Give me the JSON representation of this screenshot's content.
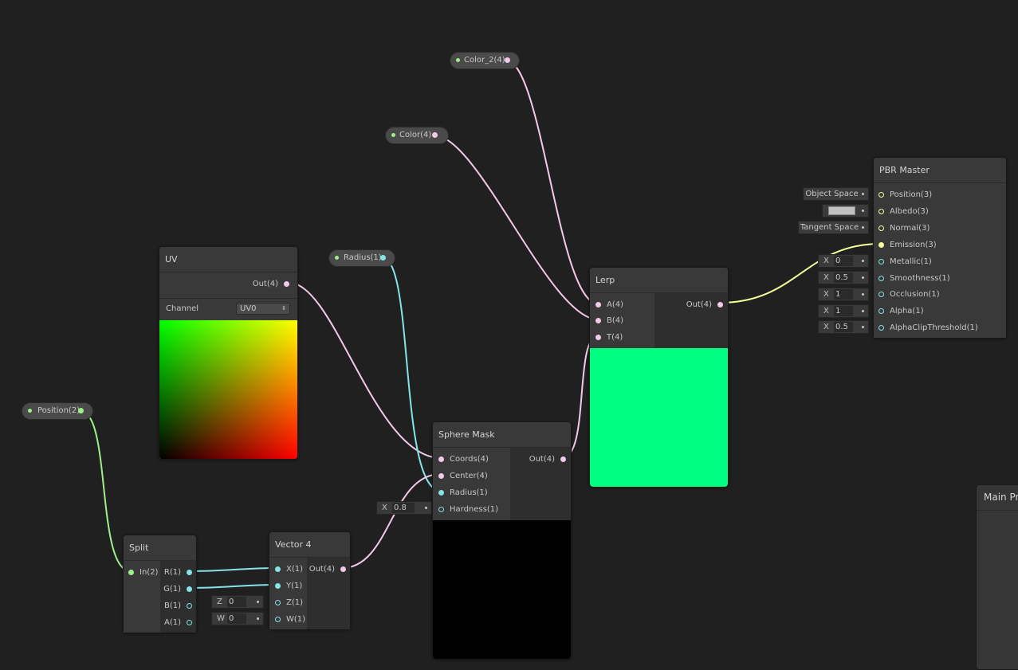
{
  "nodes": {
    "uv": {
      "title": "UV",
      "out": "Out(4)",
      "channel_label": "Channel",
      "channel_value": "UV0"
    },
    "split": {
      "title": "Split",
      "in": "In(2)",
      "outs": [
        "R(1)",
        "G(1)",
        "B(1)",
        "A(1)"
      ]
    },
    "vector4": {
      "title": "Vector 4",
      "ins": [
        "X(1)",
        "Y(1)",
        "Z(1)",
        "W(1)"
      ],
      "out": "Out(4)",
      "z_label": "Z",
      "z_value": "0",
      "w_label": "W",
      "w_value": "0"
    },
    "sphere_mask": {
      "title": "Sphere Mask",
      "ins": [
        "Coords(4)",
        "Center(4)",
        "Radius(1)",
        "Hardness(1)"
      ],
      "out": "Out(4)",
      "hardness_label": "X",
      "hardness_value": "0.8"
    },
    "lerp": {
      "title": "Lerp",
      "ins": [
        "A(4)",
        "B(4)",
        "T(4)"
      ],
      "out": "Out(4)"
    },
    "pbr_master": {
      "title": "PBR Master",
      "ins": [
        "Position(3)",
        "Albedo(3)",
        "Normal(3)",
        "Emission(3)",
        "Metallic(1)",
        "Smoothness(1)",
        "Occlusion(1)",
        "Alpha(1)",
        "AlphaClipThreshold(1)"
      ],
      "position_space": "Object Space",
      "normal_space": "Tangent Space",
      "field_label": "X",
      "metallic": "0",
      "smoothness": "0.5",
      "occlusion": "1",
      "alpha": "1",
      "alpha_clip": "0.5"
    }
  },
  "properties": {
    "color2": "Color_2(4)",
    "color": "Color(4)",
    "radius": "Radius(1)",
    "position": "Position(2)"
  },
  "main_preview": {
    "title": "Main Preview"
  },
  "colors": {
    "background": "#202020",
    "wire_vec4": "#f3c9e8",
    "wire_vec1": "#84e4e7",
    "wire_vec2": "#9ff08a",
    "wire_vec3": "#f6ff9a",
    "lerp_preview": "#00ff80"
  }
}
